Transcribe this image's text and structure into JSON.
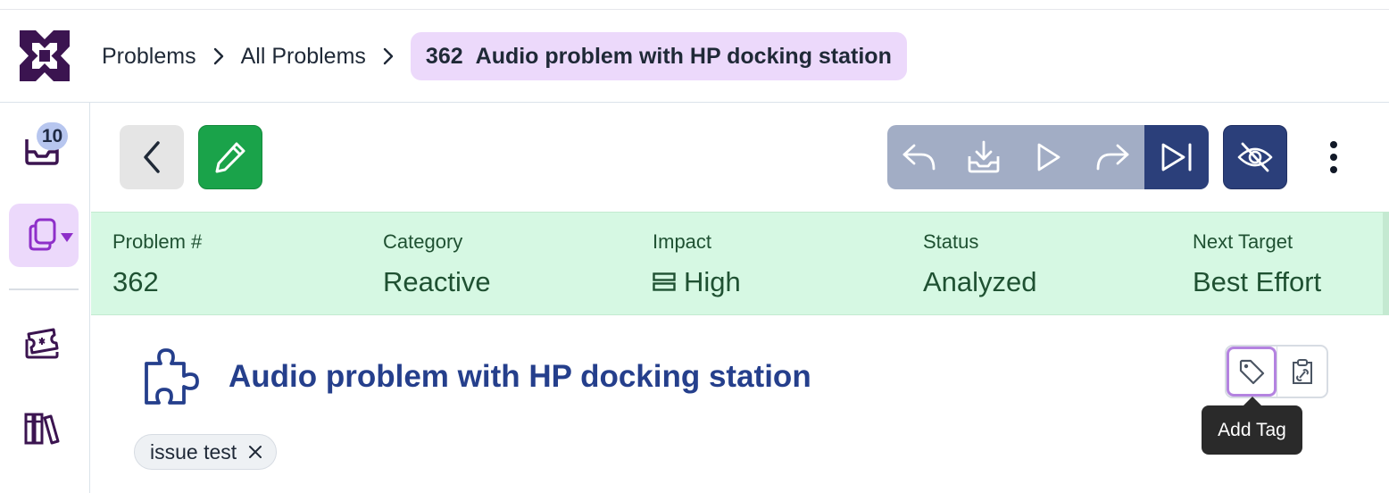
{
  "breadcrumb": {
    "items": [
      "Problems",
      "All Problems"
    ],
    "current_number": "362",
    "current_title": "Audio problem with HP docking station"
  },
  "sidebar": {
    "inbox_badge": "10",
    "items": [
      "inbox-icon",
      "copy-dropdown-icon",
      "ticket-icon",
      "library-icon"
    ]
  },
  "summary": {
    "fields": [
      {
        "label": "Problem #",
        "value": "362"
      },
      {
        "label": "Category",
        "value": "Reactive"
      },
      {
        "label": "Impact",
        "value": "High"
      },
      {
        "label": "Status",
        "value": "Analyzed"
      },
      {
        "label": "Next Target",
        "value": "Best Effort"
      }
    ]
  },
  "problem": {
    "title": "Audio problem with HP docking station",
    "tags": [
      "issue test"
    ]
  },
  "tooltip": "Add Tag",
  "colors": {
    "accent_purple": "#ecd9fb",
    "summary_green": "#d6f8e3",
    "title_blue": "#253f8c",
    "edit_green": "#1aa34a",
    "nav_dark": "#2b3f7a"
  }
}
